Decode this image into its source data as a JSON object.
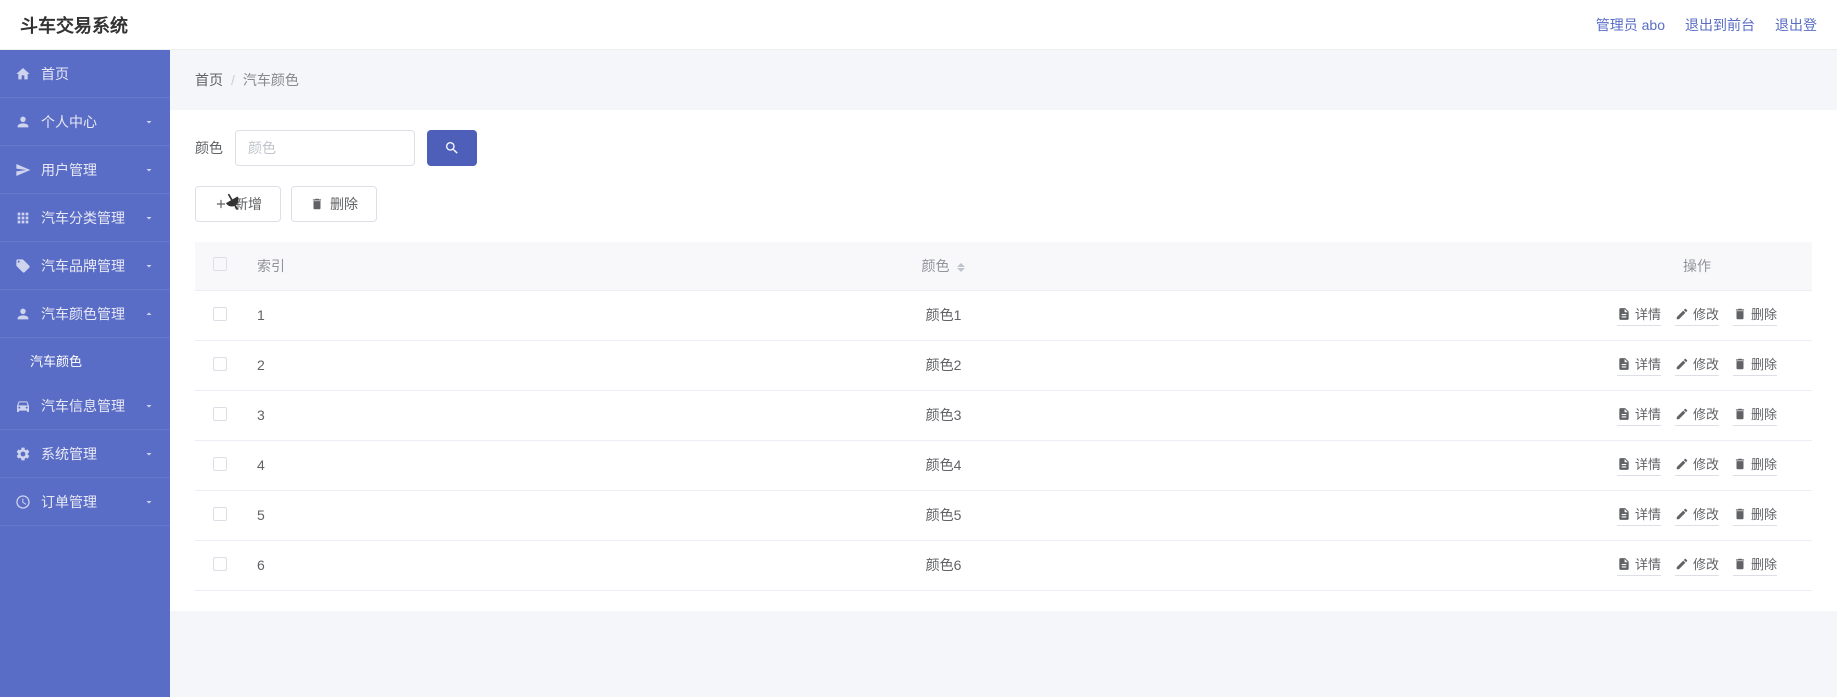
{
  "header": {
    "title": "斗车交易系统",
    "user_label": "管理员 abo",
    "logout_front": "退出到前台",
    "logout": "退出登"
  },
  "sidebar": {
    "items": [
      {
        "label": "首页",
        "icon": "home",
        "expandable": false
      },
      {
        "label": "个人中心",
        "icon": "user",
        "expandable": true,
        "expanded": false
      },
      {
        "label": "用户管理",
        "icon": "send",
        "expandable": true,
        "expanded": false
      },
      {
        "label": "汽车分类管理",
        "icon": "grid",
        "expandable": true,
        "expanded": false
      },
      {
        "label": "汽车品牌管理",
        "icon": "tag",
        "expandable": true,
        "expanded": false
      },
      {
        "label": "汽车颜色管理",
        "icon": "user",
        "expandable": true,
        "expanded": true,
        "children": [
          {
            "label": "汽车颜色"
          }
        ]
      },
      {
        "label": "汽车信息管理",
        "icon": "car",
        "expandable": true,
        "expanded": false
      },
      {
        "label": "系统管理",
        "icon": "settings",
        "expandable": true,
        "expanded": false
      },
      {
        "label": "订单管理",
        "icon": "clock",
        "expandable": true,
        "expanded": false
      }
    ]
  },
  "breadcrumb": {
    "items": [
      "首页",
      "汽车颜色"
    ]
  },
  "search": {
    "label": "颜色",
    "placeholder": "颜色"
  },
  "actions": {
    "add": "新增",
    "delete": "删除"
  },
  "table": {
    "headers": {
      "index": "索引",
      "color": "颜色",
      "actions": "操作"
    },
    "rows": [
      {
        "index": "1",
        "color": "颜色1"
      },
      {
        "index": "2",
        "color": "颜色2"
      },
      {
        "index": "3",
        "color": "颜色3"
      },
      {
        "index": "4",
        "color": "颜色4"
      },
      {
        "index": "5",
        "color": "颜色5"
      },
      {
        "index": "6",
        "color": "颜色6"
      }
    ],
    "row_actions": {
      "detail": "详情",
      "edit": "修改",
      "delete": "删除"
    }
  }
}
